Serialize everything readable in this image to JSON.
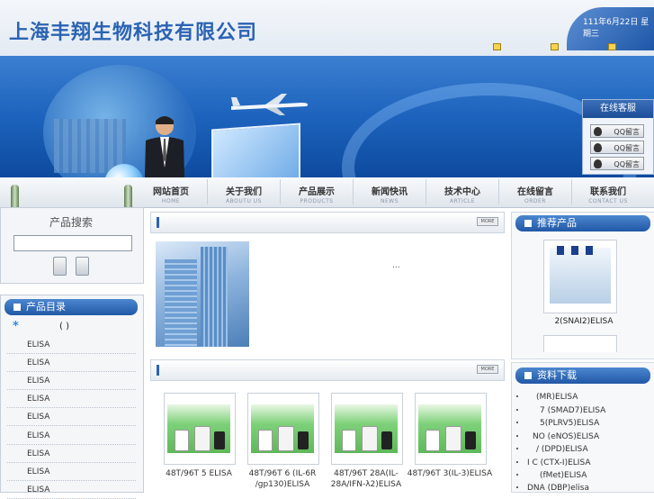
{
  "header": {
    "logo_text": "上海丰翔生物科技有限公司",
    "date_text": "111年6月22日 星期三"
  },
  "service": {
    "title": "在线客服",
    "qq_buttons": [
      "QQ留言",
      "QQ留言",
      "QQ留言"
    ]
  },
  "nav": [
    {
      "cn": "网站首页",
      "en": "HOME"
    },
    {
      "cn": "关于我们",
      "en": "ABOUTU US"
    },
    {
      "cn": "产品展示",
      "en": "PRODUCTS"
    },
    {
      "cn": "新闻快讯",
      "en": "NEWS"
    },
    {
      "cn": "技术中心",
      "en": "ARTICLE"
    },
    {
      "cn": "在线留言",
      "en": "ORDER"
    },
    {
      "cn": "联系我们",
      "en": "CONTACT US"
    }
  ],
  "search": {
    "title": "产品搜索",
    "input_value": ""
  },
  "catalog": {
    "title": "产品目录",
    "selected_star": "*",
    "selected_paren": "( )",
    "items": [
      "ELISA",
      "ELISA",
      "ELISA",
      "ELISA",
      "ELISA",
      "ELISA",
      "ELISA",
      "ELISA",
      "ELISA"
    ]
  },
  "middle": {
    "more_label": "MORE",
    "about_text": "...",
    "products": [
      "48T/96T  5 ELISA",
      "48T/96T  6 (IL-6R /gp130)ELISA",
      "48T/96T  28A(IL-28A/IFN-λ2)ELISA",
      "48T/96T  3(IL-3)ELISA"
    ]
  },
  "recommend": {
    "title": "推荐产品",
    "product_name": "2(SNAI2)ELISA"
  },
  "downloads": {
    "title": "资料下载",
    "items": [
      "(MR)ELISA",
      "7 (SMAD7)ELISA",
      "5(PLRV5)ELISA",
      "NO (eNOS)ELISA",
      "/ (DPD)ELISA",
      "I C (CTX-I)ELISA",
      "(fMet)ELISA",
      "DNA (DBP)elisa"
    ]
  },
  "colors": {
    "brand_blue": "#2b63b3",
    "header_blue": "#2158a6"
  }
}
